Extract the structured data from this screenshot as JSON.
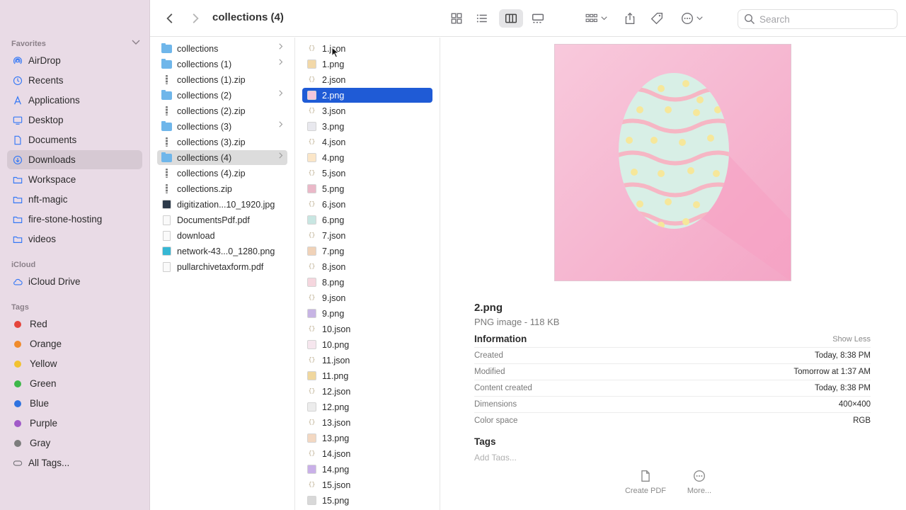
{
  "window": {
    "title": "collections (4)"
  },
  "toolbar": {
    "search_placeholder": "Search"
  },
  "sidebar": {
    "favorites_header": "Favorites",
    "favorites": [
      {
        "label": "AirDrop",
        "icon": "airdrop-icon"
      },
      {
        "label": "Recents",
        "icon": "clock-icon"
      },
      {
        "label": "Applications",
        "icon": "applications-icon"
      },
      {
        "label": "Desktop",
        "icon": "desktop-icon"
      },
      {
        "label": "Documents",
        "icon": "document-icon"
      },
      {
        "label": "Downloads",
        "icon": "download-icon"
      },
      {
        "label": "Workspace",
        "icon": "folder-icon"
      },
      {
        "label": "nft-magic",
        "icon": "folder-icon"
      },
      {
        "label": "fire-stone-hosting",
        "icon": "folder-icon"
      },
      {
        "label": "videos",
        "icon": "folder-icon"
      }
    ],
    "icloud_header": "iCloud",
    "icloud": [
      {
        "label": "iCloud Drive",
        "icon": "cloud-icon"
      }
    ],
    "tags_header": "Tags",
    "tags": [
      {
        "label": "Red",
        "color": "#e5453c"
      },
      {
        "label": "Orange",
        "color": "#f08b2c"
      },
      {
        "label": "Yellow",
        "color": "#f2c231"
      },
      {
        "label": "Green",
        "color": "#3eb84a"
      },
      {
        "label": "Blue",
        "color": "#2f73e0"
      },
      {
        "label": "Purple",
        "color": "#a15ac8"
      },
      {
        "label": "Gray",
        "color": "#7d7d7d"
      }
    ],
    "all_tags": "All Tags..."
  },
  "column1": [
    {
      "name": "collections",
      "type": "folder"
    },
    {
      "name": "collections (1)",
      "type": "folder"
    },
    {
      "name": "collections (1).zip",
      "type": "zip"
    },
    {
      "name": "collections (2)",
      "type": "folder"
    },
    {
      "name": "collections (2).zip",
      "type": "zip"
    },
    {
      "name": "collections (3)",
      "type": "folder"
    },
    {
      "name": "collections (3).zip",
      "type": "zip"
    },
    {
      "name": "collections (4)",
      "type": "folder"
    },
    {
      "name": "collections (4).zip",
      "type": "zip"
    },
    {
      "name": "collections.zip",
      "type": "zip"
    },
    {
      "name": "digitization...10_1920.jpg",
      "type": "jpg"
    },
    {
      "name": "DocumentsPdf.pdf",
      "type": "pdf"
    },
    {
      "name": "download",
      "type": "doc"
    },
    {
      "name": "network-43...0_1280.png",
      "type": "png"
    },
    {
      "name": "pullarchivetaxform.pdf",
      "type": "pdf"
    }
  ],
  "column2": [
    {
      "name": "1.json",
      "type": "json"
    },
    {
      "name": "1.png",
      "type": "png",
      "tint": "#f2d8a8"
    },
    {
      "name": "2.json",
      "type": "json"
    },
    {
      "name": "2.png",
      "type": "png",
      "tint": "#f3c6dc"
    },
    {
      "name": "3.json",
      "type": "json"
    },
    {
      "name": "3.png",
      "type": "png",
      "tint": "#e8e8ee"
    },
    {
      "name": "4.json",
      "type": "json"
    },
    {
      "name": "4.png",
      "type": "png",
      "tint": "#fbe6c8"
    },
    {
      "name": "5.json",
      "type": "json"
    },
    {
      "name": "5.png",
      "type": "png",
      "tint": "#eab8c8"
    },
    {
      "name": "6.json",
      "type": "json"
    },
    {
      "name": "6.png",
      "type": "png",
      "tint": "#c8e6e2"
    },
    {
      "name": "7.json",
      "type": "json"
    },
    {
      "name": "7.png",
      "type": "png",
      "tint": "#f0d2b8"
    },
    {
      "name": "8.json",
      "type": "json"
    },
    {
      "name": "8.png",
      "type": "png",
      "tint": "#f5d6de"
    },
    {
      "name": "9.json",
      "type": "json"
    },
    {
      "name": "9.png",
      "type": "png",
      "tint": "#c7b4e4"
    },
    {
      "name": "10.json",
      "type": "json"
    },
    {
      "name": "10.png",
      "type": "png",
      "tint": "#f6e6ee"
    },
    {
      "name": "11.json",
      "type": "json"
    },
    {
      "name": "11.png",
      "type": "png",
      "tint": "#f0d79e"
    },
    {
      "name": "12.json",
      "type": "json"
    },
    {
      "name": "12.png",
      "type": "png",
      "tint": "#ececec"
    },
    {
      "name": "13.json",
      "type": "json"
    },
    {
      "name": "13.png",
      "type": "png",
      "tint": "#f3d8c2"
    },
    {
      "name": "14.json",
      "type": "json"
    },
    {
      "name": "14.png",
      "type": "png",
      "tint": "#c9b0e8"
    },
    {
      "name": "15.json",
      "type": "json"
    },
    {
      "name": "15.png",
      "type": "png",
      "tint": "#d8d8d8"
    }
  ],
  "preview": {
    "file_name": "2.png",
    "kind": "PNG image - 118 KB",
    "info_header": "Information",
    "show_less": "Show Less",
    "rows": [
      {
        "key": "Created",
        "value": "Today, 8:38 PM"
      },
      {
        "key": "Modified",
        "value": "Tomorrow at 1:37 AM"
      },
      {
        "key": "Content created",
        "value": "Today, 8:38 PM"
      },
      {
        "key": "Dimensions",
        "value": "400×400"
      },
      {
        "key": "Color space",
        "value": "RGB"
      }
    ],
    "tags_header": "Tags",
    "add_tags": "Add Tags...",
    "actions": [
      {
        "label": "Create PDF",
        "icon": "create-pdf-icon"
      },
      {
        "label": "More...",
        "icon": "more-icon"
      }
    ]
  }
}
